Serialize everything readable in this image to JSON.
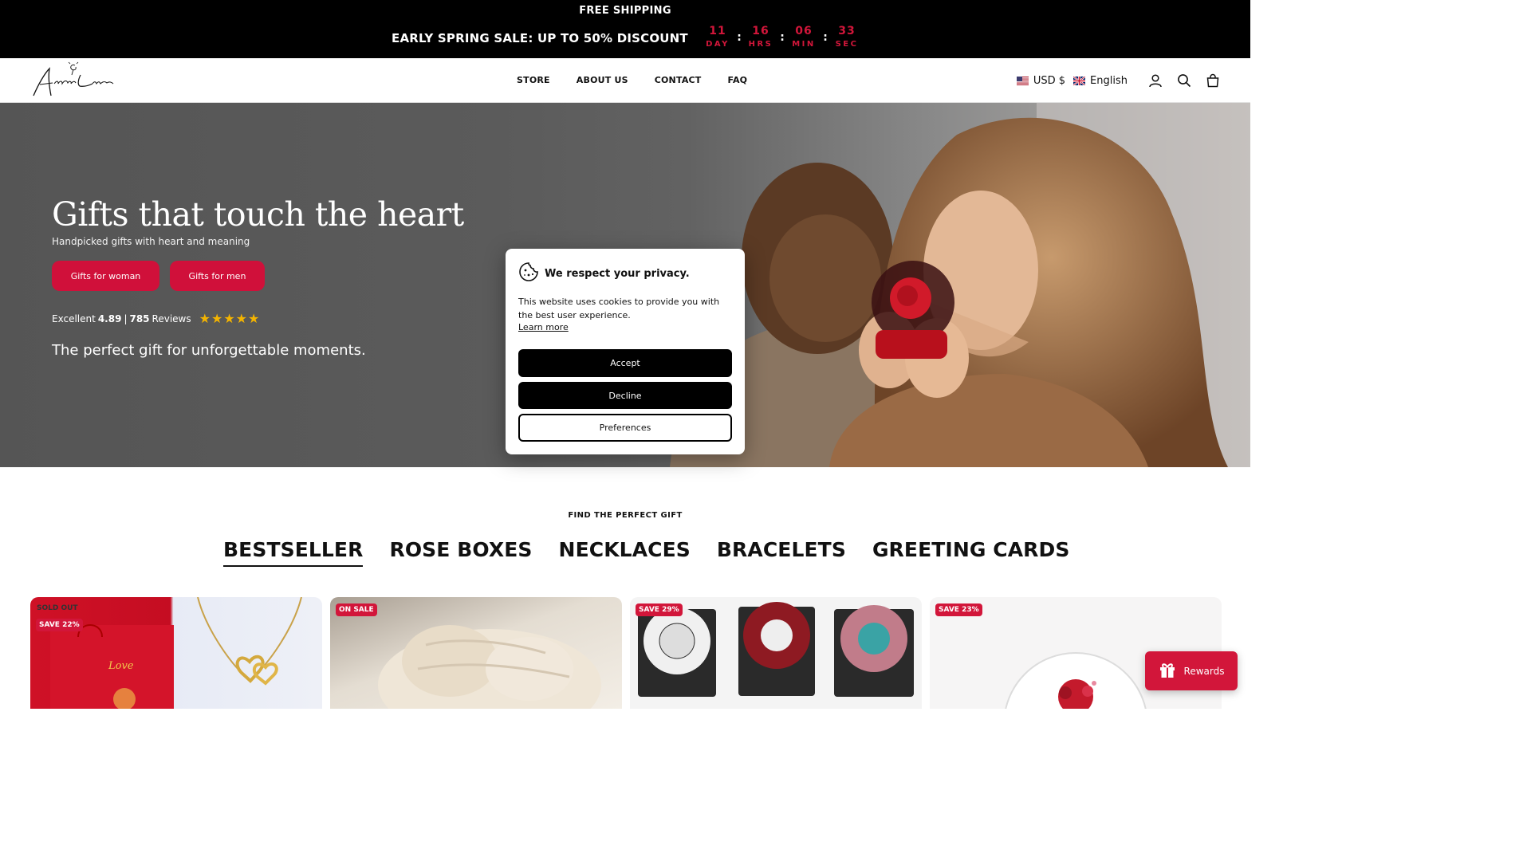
{
  "announcement": {
    "shipping": "FREE SHIPPING",
    "sale": "EARLY SPRING SALE: UP TO 50% DISCOUNT",
    "countdown": [
      {
        "value": "11",
        "label": "DAY"
      },
      {
        "value": "16",
        "label": "HRS"
      },
      {
        "value": "06",
        "label": "MIN"
      },
      {
        "value": "33",
        "label": "SEC"
      }
    ],
    "separator": ":"
  },
  "header": {
    "logo_alt": "AmorLuxe",
    "nav": [
      "STORE",
      "ABOUT US",
      "CONTACT",
      "FAQ"
    ],
    "currency": "USD $",
    "language": "English",
    "icons": [
      "account-icon",
      "search-icon",
      "cart-icon"
    ]
  },
  "hero": {
    "title": "Gifts that touch the heart",
    "subtitle": "Handpicked gifts with heart and meaning",
    "button_women": "Gifts for woman",
    "button_men": "Gifts for men",
    "rating_prefix": "Excellent",
    "rating_score": "4.89",
    "rating_sep": "|",
    "review_count": "785",
    "review_label": "Reviews",
    "stars": 5,
    "tagline": "The perfect gift for unforgettable moments."
  },
  "cookie": {
    "title": "We respect your privacy.",
    "text": "This website uses cookies to provide you with the best user experience.",
    "link": "Learn more",
    "accept": "Accept",
    "decline": "Decline",
    "preferences": "Preferences"
  },
  "section": {
    "eyebrow": "FIND THE PERFECT GIFT",
    "tabs": [
      "BESTSELLER",
      "ROSE BOXES",
      "NECKLACES",
      "BRACELETS",
      "GREETING CARDS"
    ],
    "active_tab": "BESTSELLER"
  },
  "products": [
    {
      "sold_out": "SOLD OUT",
      "badge": "SAVE 22%"
    },
    {
      "badge": "ON SALE"
    },
    {
      "badge": "SAVE 29%"
    },
    {
      "badge": "SAVE 23%"
    }
  ],
  "rewards": {
    "label": "Rewards"
  },
  "colors": {
    "accent": "#d2163a",
    "black": "#000000",
    "white": "#ffffff"
  }
}
